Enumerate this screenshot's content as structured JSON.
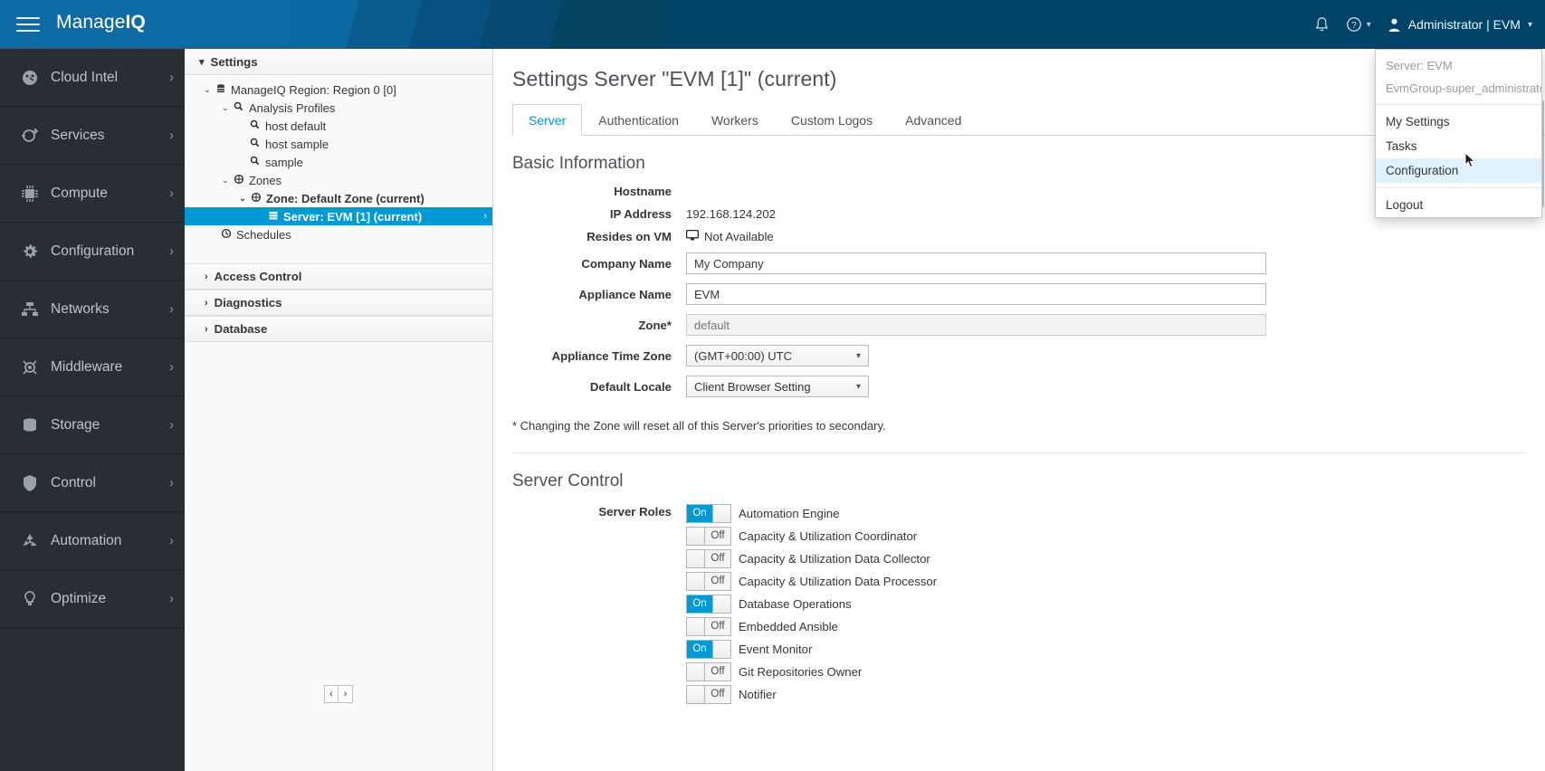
{
  "header": {
    "brand_manage": "Manage",
    "brand_iq": "IQ",
    "menu_icon": "hamburger-icon",
    "notification_icon": "bell-icon",
    "help_icon": "help-circle-icon",
    "user_icon": "user-avatar-icon",
    "user_label": "Administrator | EVM",
    "brand_color": "#0d6aa3",
    "header_color": "#004368"
  },
  "user_menu": {
    "server_line": "Server: EVM",
    "group_line": "EvmGroup-super_administrator",
    "items": [
      {
        "label": "My Settings",
        "active": false
      },
      {
        "label": "Tasks",
        "active": false
      },
      {
        "label": "Configuration",
        "active": true
      },
      {
        "label": "Logout",
        "active": false
      }
    ]
  },
  "sidebar": {
    "items": [
      {
        "label": "Cloud Intel",
        "icon": "dashboard-icon"
      },
      {
        "label": "Services",
        "icon": "services-icon"
      },
      {
        "label": "Compute",
        "icon": "chip-icon"
      },
      {
        "label": "Configuration",
        "icon": "gear-icon"
      },
      {
        "label": "Networks",
        "icon": "network-icon"
      },
      {
        "label": "Middleware",
        "icon": "middleware-icon"
      },
      {
        "label": "Storage",
        "icon": "database-icon"
      },
      {
        "label": "Control",
        "icon": "shield-icon"
      },
      {
        "label": "Automation",
        "icon": "recycle-icon"
      },
      {
        "label": "Optimize",
        "icon": "lightbulb-icon"
      }
    ],
    "arrow": "›"
  },
  "tree_panel": {
    "accordion_title": "Settings",
    "nodes": [
      {
        "label": "ManageIQ Region: Region 0 [0]",
        "icon": "region-icon",
        "indent": 0,
        "chevron": "⌄",
        "selected": false,
        "bold": false
      },
      {
        "label": "Analysis Profiles",
        "icon": "search-icon",
        "indent": 1,
        "chevron": "⌄",
        "selected": false,
        "bold": false
      },
      {
        "label": "host default",
        "icon": "search-icon",
        "indent": 2,
        "chevron": "",
        "selected": false,
        "bold": false
      },
      {
        "label": "host sample",
        "icon": "search-icon",
        "indent": 2,
        "chevron": "",
        "selected": false,
        "bold": false
      },
      {
        "label": "sample",
        "icon": "search-icon",
        "indent": 2,
        "chevron": "",
        "selected": false,
        "bold": false
      },
      {
        "label": "Zones",
        "icon": "zone-icon",
        "indent": 1,
        "chevron": "⌄",
        "selected": false,
        "bold": false
      },
      {
        "label": "Zone: Default Zone (current)",
        "icon": "zone-icon",
        "indent": 2,
        "chevron": "⌄",
        "selected": false,
        "bold": true
      },
      {
        "label": "Server: EVM [1] (current)",
        "icon": "server-icon",
        "indent": 3,
        "chevron": "",
        "selected": true,
        "bold": true
      },
      {
        "label": "Schedules",
        "icon": "clock-icon",
        "indent": 1,
        "chevron": "",
        "selected": false,
        "bold": false
      }
    ],
    "closed_accordions": [
      {
        "label": "Access Control",
        "chevron": "›"
      },
      {
        "label": "Diagnostics",
        "chevron": "›"
      },
      {
        "label": "Database",
        "chevron": "›"
      }
    ],
    "pager_prev": "‹",
    "pager_next": "›"
  },
  "main": {
    "page_title": "Settings Server \"EVM [1]\" (current)",
    "tabs": [
      {
        "label": "Server",
        "active": true
      },
      {
        "label": "Authentication",
        "active": false
      },
      {
        "label": "Workers",
        "active": false
      },
      {
        "label": "Custom Logos",
        "active": false
      },
      {
        "label": "Advanced",
        "active": false
      }
    ],
    "basic_information": {
      "title": "Basic Information",
      "hostname_label": "Hostname",
      "hostname_value": "",
      "ip_label": "IP Address",
      "ip_value": "192.168.124.202",
      "resides_label": "Resides on VM",
      "resides_value": "Not Available",
      "resides_icon": "monitor-icon",
      "company_label": "Company Name",
      "company_value": "My Company",
      "appliance_label": "Appliance Name",
      "appliance_value": "EVM",
      "zone_label": "Zone*",
      "zone_placeholder": "default",
      "timezone_label": "Appliance Time Zone",
      "timezone_value": "(GMT+00:00) UTC",
      "locale_label": "Default Locale",
      "locale_value": "Client Browser Setting",
      "note": "* Changing the Zone will reset all of this Server's priorities to secondary."
    },
    "server_control": {
      "title": "Server Control",
      "roles_label": "Server Roles",
      "on_text": "On",
      "off_text": "Off",
      "roles": [
        {
          "name": "Automation Engine",
          "on": true
        },
        {
          "name": "Capacity & Utilization Coordinator",
          "on": false
        },
        {
          "name": "Capacity & Utilization Data Collector",
          "on": false
        },
        {
          "name": "Capacity & Utilization Data Processor",
          "on": false
        },
        {
          "name": "Database Operations",
          "on": true
        },
        {
          "name": "Embedded Ansible",
          "on": false
        },
        {
          "name": "Event Monitor",
          "on": true
        },
        {
          "name": "Git Repositories Owner",
          "on": false
        },
        {
          "name": "Notifier",
          "on": false
        }
      ]
    }
  }
}
